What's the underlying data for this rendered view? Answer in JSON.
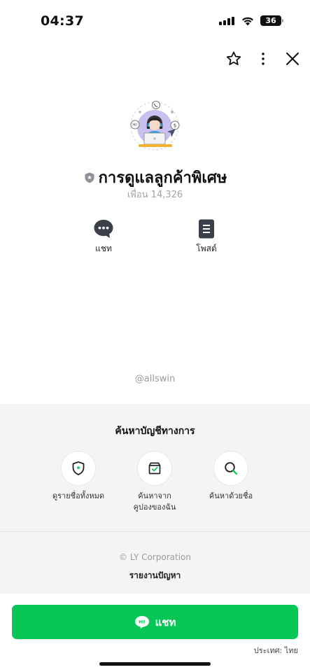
{
  "status_bar": {
    "time": "04:37",
    "battery": "36",
    "icons": [
      "cellular-signal-icon",
      "wifi-icon",
      "battery-icon"
    ]
  },
  "top_actions": {
    "icons": [
      "star-icon",
      "more-vertical-icon",
      "close-icon"
    ]
  },
  "profile": {
    "name": "การดูแลลูกค้าพิเศษ",
    "friends": "เพื่อน 14,326",
    "badge_icon": "verified-shield-icon",
    "avatar": "customer-support-avatar"
  },
  "actions": {
    "chat_label": "แชท",
    "post_label": "โพสต์"
  },
  "handle": "@allswin",
  "official_section": {
    "title": "ค้นหาบัญชีทางการ",
    "items": [
      {
        "label": "ดูรายชื่อทั้งหมด",
        "icon": "shield-list-icon"
      },
      {
        "label_line1": "ค้นหาจาก",
        "label_line2": "คูปองของฉัน",
        "icon": "coupon-box-icon"
      },
      {
        "label": "ค้นหาด้วยชื่อ",
        "icon": "search-icon"
      }
    ]
  },
  "footer": {
    "copyright": "© LY Corporation",
    "report": "รายงานปัญหา"
  },
  "chat_button": {
    "label": "แชท",
    "icon": "line-chat-bubble-icon"
  },
  "country": "ประเทศ: ไทย",
  "colors": {
    "accent_green": "#06c755",
    "section_gray": "#f4f4f4",
    "muted_text": "#9b9b9b"
  }
}
